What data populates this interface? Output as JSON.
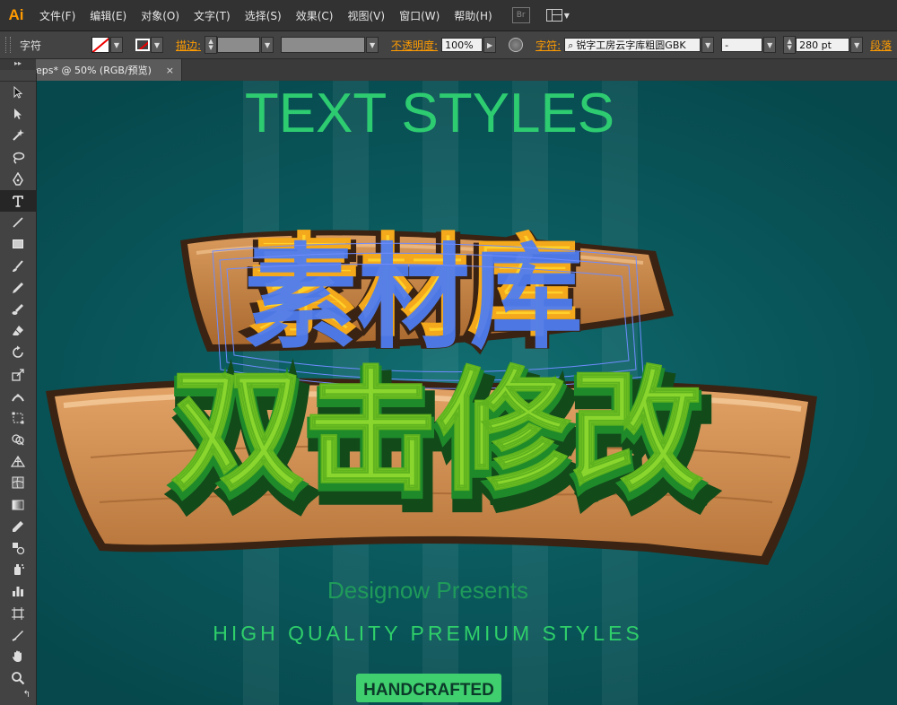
{
  "app": {
    "logo": "Ai"
  },
  "menu": {
    "items": [
      "文件(F)",
      "编辑(E)",
      "对象(O)",
      "文字(T)",
      "选择(S)",
      "效果(C)",
      "视图(V)",
      "窗口(W)",
      "帮助(H)"
    ],
    "bridge": "Br"
  },
  "control": {
    "context_label": "字符",
    "stroke_label": "描边:",
    "opacity_label": "不透明度:",
    "opacity_value": "100%",
    "char_label": "字符:",
    "font_value": "锐字工房云字库粗圆GBK",
    "style_value": "-",
    "size_value": "280 pt",
    "para_label": "段落"
  },
  "document": {
    "tab_title": "eps* @ 50% (RGB/预览)",
    "close": "×"
  },
  "artwork": {
    "title": "TEXT STYLES",
    "main_text": "素材库",
    "sub_text": "双击修改",
    "presenter": "Designow Presents",
    "tagline": "HIGH QUALITY PREMIUM STYLES",
    "badge": "HANDCRAFTED"
  },
  "colors": {
    "accent": "#ff9c00",
    "title_green": "#2ecc71",
    "badge_green": "#3fcf6e",
    "selection_blue": "#4f7df0",
    "wood": "#c9874a"
  }
}
